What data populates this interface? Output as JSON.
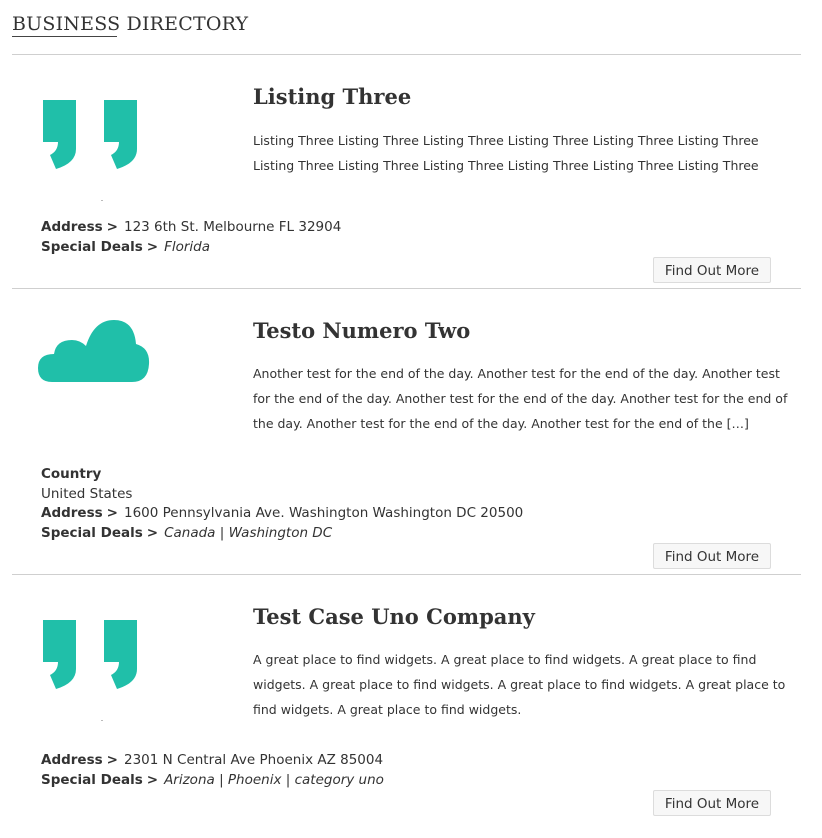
{
  "page": {
    "title": "BUSINESS DIRECTORY",
    "accent_color": "#20bfa9"
  },
  "listings": [
    {
      "icon": "quote-icon",
      "title": "Listing Three",
      "description": "Listing Three Listing Three Listing Three Listing Three Listing Three Listing Three Listing Three Listing Three Listing Three Listing Three Listing Three Listing Three",
      "address_label": "Address",
      "address": "123 6th St. Melbourne FL 32904",
      "deals_label": "Special Deals",
      "deals": "Florida",
      "button_label": "Find Out More"
    },
    {
      "icon": "cloud-icon",
      "title": "Testo Numero Two",
      "description": "Another test for the end of the  day. Another test for the end of the  day. Another test for the end of the  day. Another test for the end of the  day. Another test for the end of the  day. Another test for the end of the  day. Another test for the end of the  […]",
      "country_label": "Country",
      "country": "United States",
      "address_label": "Address",
      "address": "1600 Pennsylvania Ave. Washington Washington DC 20500",
      "deals_label": "Special Deals",
      "deals": "Canada | Washington DC",
      "button_label": "Find Out More"
    },
    {
      "icon": "quote-icon",
      "title": "Test Case Uno Company",
      "description": "A great place to find widgets. A great place to find widgets. A great place to find widgets. A great place to find widgets. A great place to find widgets. A great place to find widgets. A great place to find widgets.",
      "address_label": "Address",
      "address": "2301 N Central Ave Phoenix AZ 85004",
      "deals_label": "Special Deals",
      "deals": "Arizona | Phoenix | category uno",
      "button_label": "Find Out More"
    }
  ]
}
